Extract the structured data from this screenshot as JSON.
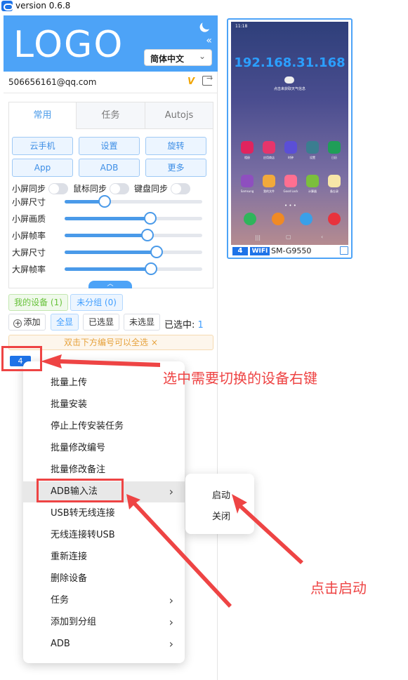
{
  "window": {
    "title": "version 0.6.8"
  },
  "header": {
    "logo": "LOGO",
    "language": "简体中文",
    "collapse": "«"
  },
  "account": {
    "email": "506656161@qq.com",
    "vip": "V"
  },
  "tabs": [
    {
      "label": "常用"
    },
    {
      "label": "任务"
    },
    {
      "label": "Autojs"
    }
  ],
  "buttons": [
    {
      "label": "云手机"
    },
    {
      "label": "设置"
    },
    {
      "label": "旋转"
    },
    {
      "label": "App"
    },
    {
      "label": "ADB"
    },
    {
      "label": "更多"
    }
  ],
  "toggles": [
    {
      "label": "小屏同步",
      "on": false
    },
    {
      "label": "鼠标同步",
      "on": false
    },
    {
      "label": "键盘同步",
      "on": false
    }
  ],
  "sliders": [
    {
      "label": "小屏尺寸",
      "value": 0.29
    },
    {
      "label": "小屏画质",
      "value": 0.62
    },
    {
      "label": "小屏帧率",
      "value": 0.6
    },
    {
      "label": "大屏尺寸",
      "value": 0.67
    },
    {
      "label": "大屏帧率",
      "value": 0.63
    }
  ],
  "groups": {
    "my_devices": "我的设备 (1)",
    "ungrouped": "未分组 (0)"
  },
  "toolbar": {
    "add": "添加",
    "show_all": "全显",
    "show_selected": "已选显",
    "show_unselected": "未选显",
    "selected_label": "已选中:",
    "selected_count": "1"
  },
  "hint": {
    "text": "双击下方编号可以全选",
    "close": "×"
  },
  "device": {
    "number": "4"
  },
  "context_menu": {
    "items": [
      {
        "label": "批量上传",
        "submenu": false
      },
      {
        "label": "批量安装",
        "submenu": false
      },
      {
        "label": "停止上传安装任务",
        "submenu": false
      },
      {
        "label": "批量修改编号",
        "submenu": false
      },
      {
        "label": "批量修改备注",
        "submenu": false
      },
      {
        "label": "ADB输入法",
        "submenu": true
      },
      {
        "label": "USB转无线连接",
        "submenu": false
      },
      {
        "label": "无线连接转USB",
        "submenu": false
      },
      {
        "label": "重新连接",
        "submenu": false
      },
      {
        "label": "删除设备",
        "submenu": false
      },
      {
        "label": "任务",
        "submenu": true
      },
      {
        "label": "添加到分组",
        "submenu": true
      },
      {
        "label": "ADB",
        "submenu": true
      }
    ],
    "arrow": "›"
  },
  "submenu": {
    "items": [
      {
        "label": "启动"
      },
      {
        "label": "关闭"
      }
    ]
  },
  "annotations": {
    "right_click": "选中需要切换的设备右键",
    "click_start": "点击启动"
  },
  "phone": {
    "ip": "192.168.31.168",
    "status_time": "11:18",
    "weather": "点击来获取天气信息",
    "number": "4",
    "connection": "WIFI",
    "model": "SM-G9550",
    "apps": [
      {
        "label": "相册",
        "color": "#e0245e"
      },
      {
        "label": "应用商店",
        "color": "#e6356b"
      },
      {
        "label": "时钟",
        "color": "#5b4fd6"
      },
      {
        "label": "设置",
        "color": "#3b7d90"
      },
      {
        "label": "日历",
        "color": "#1f9e58"
      },
      {
        "label": "Samsung",
        "color": "#8e4fbf"
      },
      {
        "label": "我的文件",
        "color": "#f2a93b"
      },
      {
        "label": "Good Lock",
        "color": "#ff6f91"
      },
      {
        "label": "计算器",
        "color": "#7bbf3d"
      },
      {
        "label": "备忘录",
        "color": "#f7e6a8"
      }
    ],
    "dock": [
      {
        "color": "#2fb55b"
      },
      {
        "color": "#f08a24"
      },
      {
        "color": "#3aa0e8"
      },
      {
        "color": "#e8333d"
      }
    ]
  }
}
